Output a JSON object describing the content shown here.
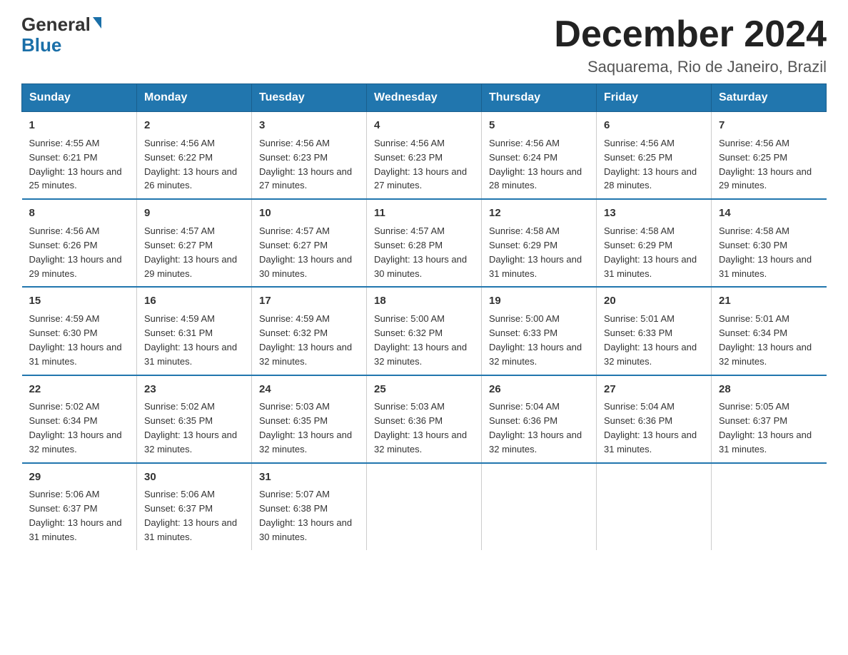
{
  "header": {
    "logo_general": "General",
    "logo_blue": "Blue",
    "month_title": "December 2024",
    "location": "Saquarema, Rio de Janeiro, Brazil"
  },
  "calendar": {
    "days_of_week": [
      "Sunday",
      "Monday",
      "Tuesday",
      "Wednesday",
      "Thursday",
      "Friday",
      "Saturday"
    ],
    "weeks": [
      [
        {
          "day": "1",
          "sunrise": "4:55 AM",
          "sunset": "6:21 PM",
          "daylight": "13 hours and 25 minutes."
        },
        {
          "day": "2",
          "sunrise": "4:56 AM",
          "sunset": "6:22 PM",
          "daylight": "13 hours and 26 minutes."
        },
        {
          "day": "3",
          "sunrise": "4:56 AM",
          "sunset": "6:23 PM",
          "daylight": "13 hours and 27 minutes."
        },
        {
          "day": "4",
          "sunrise": "4:56 AM",
          "sunset": "6:23 PM",
          "daylight": "13 hours and 27 minutes."
        },
        {
          "day": "5",
          "sunrise": "4:56 AM",
          "sunset": "6:24 PM",
          "daylight": "13 hours and 28 minutes."
        },
        {
          "day": "6",
          "sunrise": "4:56 AM",
          "sunset": "6:25 PM",
          "daylight": "13 hours and 28 minutes."
        },
        {
          "day": "7",
          "sunrise": "4:56 AM",
          "sunset": "6:25 PM",
          "daylight": "13 hours and 29 minutes."
        }
      ],
      [
        {
          "day": "8",
          "sunrise": "4:56 AM",
          "sunset": "6:26 PM",
          "daylight": "13 hours and 29 minutes."
        },
        {
          "day": "9",
          "sunrise": "4:57 AM",
          "sunset": "6:27 PM",
          "daylight": "13 hours and 29 minutes."
        },
        {
          "day": "10",
          "sunrise": "4:57 AM",
          "sunset": "6:27 PM",
          "daylight": "13 hours and 30 minutes."
        },
        {
          "day": "11",
          "sunrise": "4:57 AM",
          "sunset": "6:28 PM",
          "daylight": "13 hours and 30 minutes."
        },
        {
          "day": "12",
          "sunrise": "4:58 AM",
          "sunset": "6:29 PM",
          "daylight": "13 hours and 31 minutes."
        },
        {
          "day": "13",
          "sunrise": "4:58 AM",
          "sunset": "6:29 PM",
          "daylight": "13 hours and 31 minutes."
        },
        {
          "day": "14",
          "sunrise": "4:58 AM",
          "sunset": "6:30 PM",
          "daylight": "13 hours and 31 minutes."
        }
      ],
      [
        {
          "day": "15",
          "sunrise": "4:59 AM",
          "sunset": "6:30 PM",
          "daylight": "13 hours and 31 minutes."
        },
        {
          "day": "16",
          "sunrise": "4:59 AM",
          "sunset": "6:31 PM",
          "daylight": "13 hours and 31 minutes."
        },
        {
          "day": "17",
          "sunrise": "4:59 AM",
          "sunset": "6:32 PM",
          "daylight": "13 hours and 32 minutes."
        },
        {
          "day": "18",
          "sunrise": "5:00 AM",
          "sunset": "6:32 PM",
          "daylight": "13 hours and 32 minutes."
        },
        {
          "day": "19",
          "sunrise": "5:00 AM",
          "sunset": "6:33 PM",
          "daylight": "13 hours and 32 minutes."
        },
        {
          "day": "20",
          "sunrise": "5:01 AM",
          "sunset": "6:33 PM",
          "daylight": "13 hours and 32 minutes."
        },
        {
          "day": "21",
          "sunrise": "5:01 AM",
          "sunset": "6:34 PM",
          "daylight": "13 hours and 32 minutes."
        }
      ],
      [
        {
          "day": "22",
          "sunrise": "5:02 AM",
          "sunset": "6:34 PM",
          "daylight": "13 hours and 32 minutes."
        },
        {
          "day": "23",
          "sunrise": "5:02 AM",
          "sunset": "6:35 PM",
          "daylight": "13 hours and 32 minutes."
        },
        {
          "day": "24",
          "sunrise": "5:03 AM",
          "sunset": "6:35 PM",
          "daylight": "13 hours and 32 minutes."
        },
        {
          "day": "25",
          "sunrise": "5:03 AM",
          "sunset": "6:36 PM",
          "daylight": "13 hours and 32 minutes."
        },
        {
          "day": "26",
          "sunrise": "5:04 AM",
          "sunset": "6:36 PM",
          "daylight": "13 hours and 32 minutes."
        },
        {
          "day": "27",
          "sunrise": "5:04 AM",
          "sunset": "6:36 PM",
          "daylight": "13 hours and 31 minutes."
        },
        {
          "day": "28",
          "sunrise": "5:05 AM",
          "sunset": "6:37 PM",
          "daylight": "13 hours and 31 minutes."
        }
      ],
      [
        {
          "day": "29",
          "sunrise": "5:06 AM",
          "sunset": "6:37 PM",
          "daylight": "13 hours and 31 minutes."
        },
        {
          "day": "30",
          "sunrise": "5:06 AM",
          "sunset": "6:37 PM",
          "daylight": "13 hours and 31 minutes."
        },
        {
          "day": "31",
          "sunrise": "5:07 AM",
          "sunset": "6:38 PM",
          "daylight": "13 hours and 30 minutes."
        },
        null,
        null,
        null,
        null
      ]
    ]
  }
}
